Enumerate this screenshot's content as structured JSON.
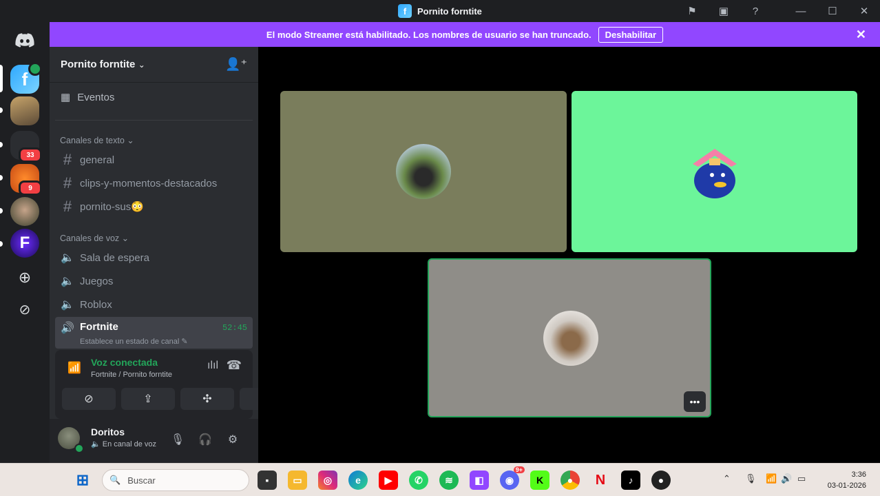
{
  "titlebar": {
    "title": "Pornito forntite",
    "app_icon_letter": "f"
  },
  "banner": {
    "message": "El modo Streamer está habilitado. Los nombres de usuario se han truncado.",
    "button": "Deshabilitar"
  },
  "rail": {
    "badges": [
      "33",
      "9"
    ]
  },
  "server": {
    "name": "Pornito forntite"
  },
  "events_label": "Eventos",
  "categories": {
    "text": "Canales de texto",
    "voice": "Canales de voz"
  },
  "text_channels": [
    "general",
    "clips-y-momentos-destacados",
    "pornito-sus😳"
  ],
  "voice_channels": [
    "Sala de espera",
    "Juegos",
    "Roblox"
  ],
  "active_channel": {
    "name": "Fortnite",
    "timer": "52:45",
    "subtitle": "Establece un estado de canal"
  },
  "voice_panel": {
    "status": "Voz conectada",
    "location": "Fortnite / Pornito forntite"
  },
  "user": {
    "name": "Doritos",
    "status": "En canal de voz"
  },
  "tiles": {
    "colors": [
      "#7a7d5c",
      "#6cf59a",
      "#8f8d88"
    ]
  },
  "taskbar": {
    "search_placeholder": "Buscar",
    "discord_badge": "9+",
    "time": "3:36",
    "date": "03-01-2026"
  }
}
